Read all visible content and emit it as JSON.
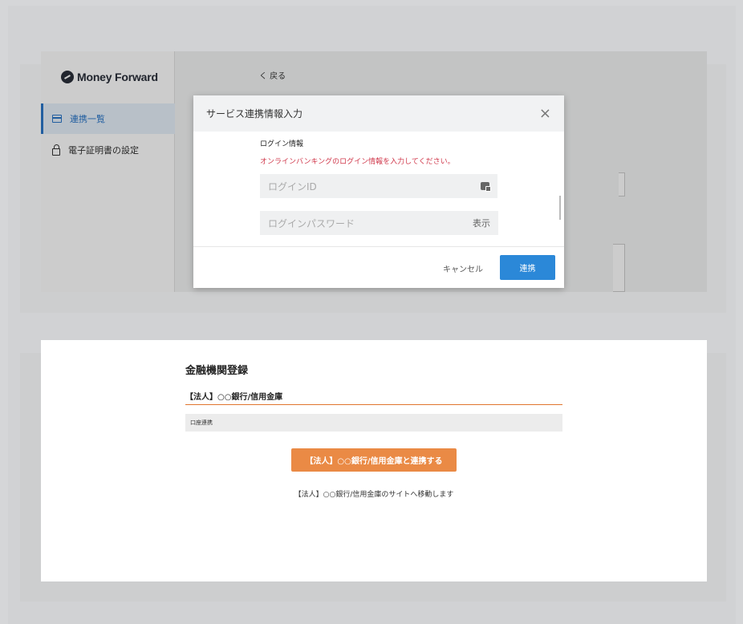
{
  "app": {
    "logo_text": "Money Forward",
    "logo_icon": "money-forward-logo-mark"
  },
  "sidebar": {
    "items": [
      {
        "label": "連携一覧",
        "icon": "card-icon",
        "active": true
      },
      {
        "label": "電子証明書の設定",
        "icon": "lock-icon",
        "active": false
      }
    ]
  },
  "main": {
    "back_label": "く 戻る"
  },
  "modal": {
    "title": "サービス連携情報入力",
    "close_symbol": "×",
    "login_section_title": "ログイン情報",
    "login_message": "オンラインバンキングのログイン情報を入力してください。",
    "login_id_placeholder": "ログインID",
    "password_placeholder": "ログインパスワード",
    "show_label": "表示",
    "cancel_label": "キャンセル",
    "submit_label": "連携"
  },
  "registration": {
    "title": "金融機関登録",
    "bank_name": "【法人】○○銀行/信用金庫",
    "account_link_label": "口座連携",
    "link_button_label": "【法人】○○銀行/信用金庫と連携する",
    "move_note": "【法人】○○銀行/信用金庫のサイトへ移動します"
  },
  "colors": {
    "primary_blue": "#2b88d8",
    "accent_orange": "#ea8a45",
    "error_red": "#d0384b"
  }
}
